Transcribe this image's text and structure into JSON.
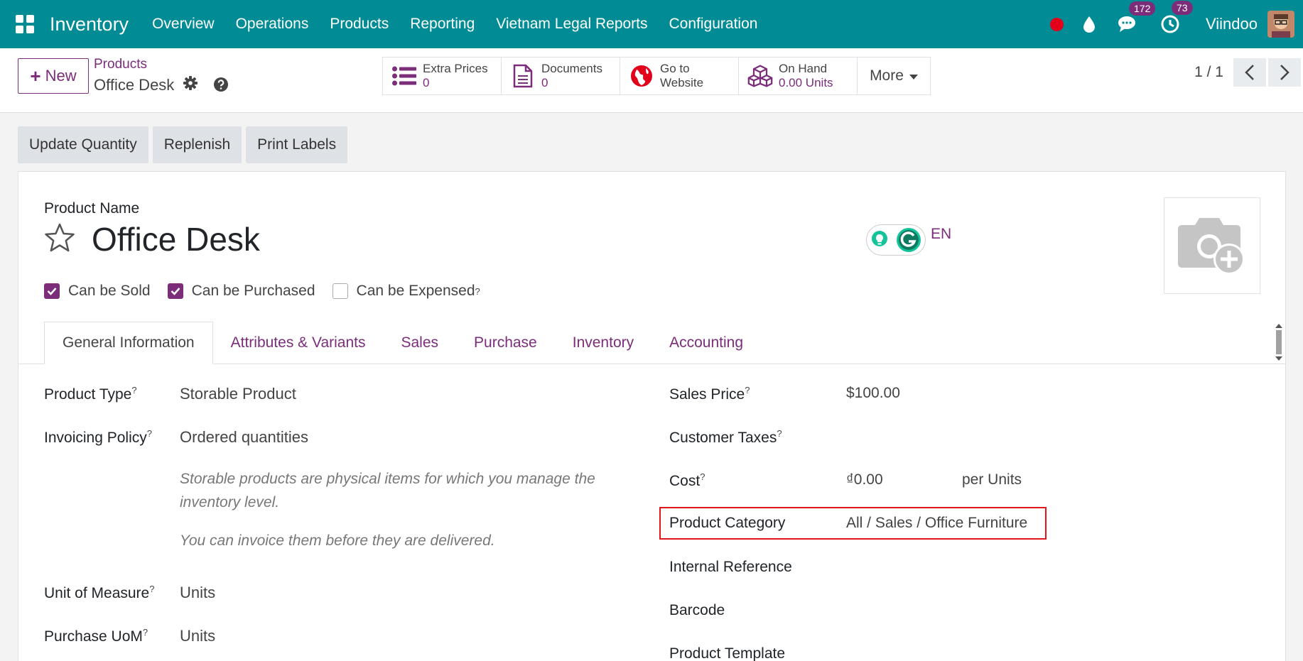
{
  "navbar": {
    "app_title": "Inventory",
    "menu": [
      "Overview",
      "Operations",
      "Products",
      "Reporting",
      "Vietnam Legal Reports",
      "Configuration"
    ],
    "messages_count": "172",
    "activities_count": "73",
    "user_name": "Viindoo"
  },
  "control": {
    "new_label": "New",
    "breadcrumb_parent": "Products",
    "breadcrumb_current": "Office Desk",
    "smart_buttons": [
      {
        "label": "Extra Prices",
        "value": "0"
      },
      {
        "label": "Documents",
        "value": "0"
      },
      {
        "label": "Go to",
        "value": "Website"
      },
      {
        "label": "On Hand",
        "value": "0.00 Units"
      }
    ],
    "more_label": "More",
    "pager": "1 / 1"
  },
  "actions": [
    "Update Quantity",
    "Replenish",
    "Print Labels"
  ],
  "form": {
    "product_name_label": "Product Name",
    "product_name": "Office Desk",
    "lang": "EN",
    "checkboxes": [
      {
        "label": "Can be Sold",
        "checked": true
      },
      {
        "label": "Can be Purchased",
        "checked": true
      },
      {
        "label": "Can be Expensed",
        "checked": false
      }
    ],
    "tabs": [
      "General Information",
      "Attributes & Variants",
      "Sales",
      "Purchase",
      "Inventory",
      "Accounting"
    ],
    "left_fields": {
      "product_type_label": "Product Type",
      "product_type": "Storable Product",
      "invoicing_label": "Invoicing Policy",
      "invoicing": "Ordered quantities",
      "help1": "Storable products are physical items for which you manage the inventory level.",
      "help2": "You can invoice them before they are delivered.",
      "uom_label": "Unit of Measure",
      "uom": "Units",
      "purchase_uom_label": "Purchase UoM",
      "purchase_uom": "Units"
    },
    "right_fields": {
      "sales_price_label": "Sales Price",
      "sales_price": "$100.00",
      "customer_taxes_label": "Customer Taxes",
      "cost_label": "Cost",
      "cost": "₫0.00",
      "cost_unit": "per Units",
      "category_label": "Product Category",
      "category": "All / Sales / Office Furniture",
      "internal_ref_label": "Internal Reference",
      "barcode_label": "Barcode",
      "template_label": "Product Template"
    }
  }
}
